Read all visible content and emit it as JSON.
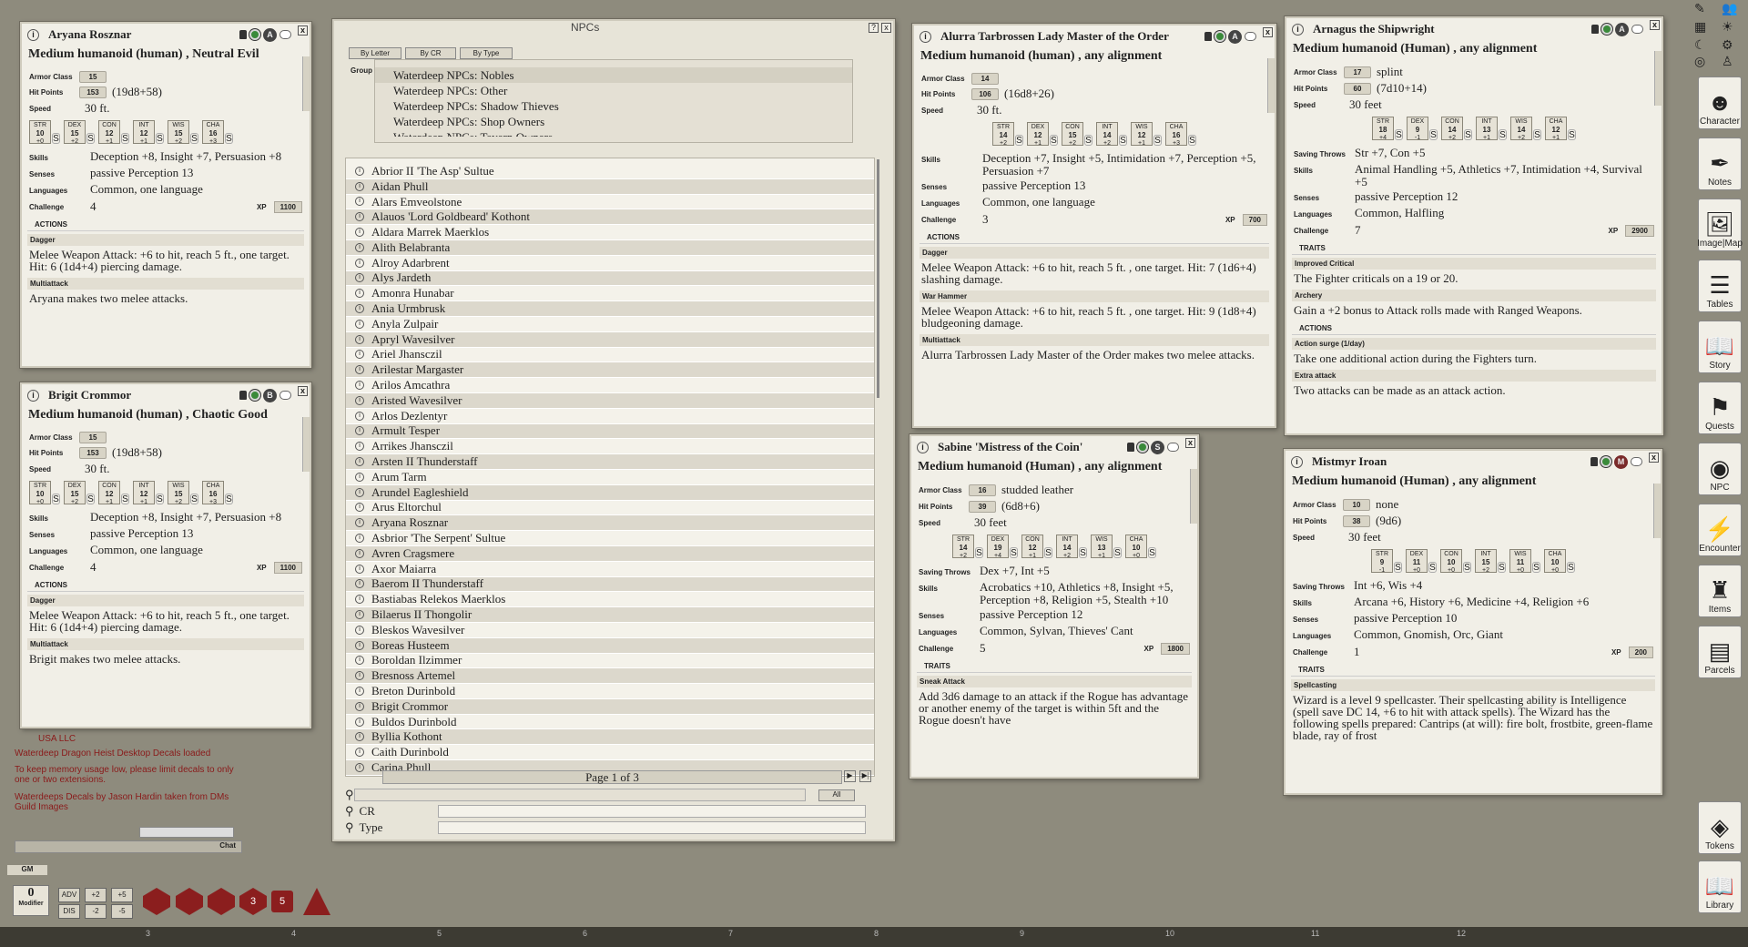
{
  "npc_window": {
    "title": "NPCs",
    "tabs": [
      "By Letter",
      "By CR",
      "By Type"
    ],
    "group_label": "Group",
    "groups": [
      "Waterdeep NPCs: Nobles",
      "Waterdeep NPCs: Other",
      "Waterdeep NPCs: Shadow Thieves",
      "Waterdeep NPCs: Shop Owners",
      "Waterdeep NPCs: Tavern Owners"
    ],
    "names": [
      "Abrior II 'The Asp' Sultue",
      "Aidan Phull",
      "Alars Emveolstone",
      "Alauos 'Lord Goldbeard' Kothont",
      "Aldara Marrek Maerklos",
      "Alith Belabranta",
      "Alroy Adarbrent",
      "Alys Jardeth",
      "Amonra Hunabar",
      "Ania Urmbrusk",
      "Anyla Zulpair",
      "Apryl Wavesilver",
      "Ariel Jhansczil",
      "Arilestar Margaster",
      "Arilos Amcathra",
      "Aristed Wavesilver",
      "Arlos Dezlentyr",
      "Armult Tesper",
      "Arrikes Jhansczil",
      "Arsten II Thunderstaff",
      "Arum Tarm",
      "Arundel Eagleshield",
      "Arus Eltorchul",
      "Aryana Rosznar",
      "Asbrior 'The Serpent' Sultue",
      "Avren Cragsmere",
      "Axor Maiarra",
      "Baerom II Thunderstaff",
      "Bastiabas Relekos Maerklos",
      "Bilaerus II Thongolir",
      "Bleskos Wavesilver",
      "Boreas Husteem",
      "Boroldan Ilzimmer",
      "Bresnoss Artemel",
      "Breton Durinbold",
      "Brigit Crommor",
      "Buldos Durinbold",
      "Byllia Kothont",
      "Caith Durinbold",
      "Carina Phull"
    ],
    "pager": "Page 1 of 3",
    "filter_all": "All",
    "filter_cr": "CR",
    "filter_type": "Type"
  },
  "cards": [
    {
      "name": "Aryana Rosznar",
      "token": "A",
      "type": "Medium humanoid (human) , Neutral Evil",
      "ac": "15",
      "ac_text": "",
      "hp": "153",
      "hp_text": "(19d8+58)",
      "speed": "30 ft.",
      "abil": [
        [
          "STR",
          "10",
          "+0"
        ],
        [
          "DEX",
          "15",
          "+2"
        ],
        [
          "CON",
          "12",
          "+1"
        ],
        [
          "INT",
          "12",
          "+1"
        ],
        [
          "WIS",
          "15",
          "+2"
        ],
        [
          "CHA",
          "16",
          "+3"
        ]
      ],
      "saves": "",
      "skills": "Deception +8, Insight +7, Persuasion +8",
      "senses": "passive Perception 13",
      "languages": "Common, one language",
      "challenge": "4",
      "xp": "1100",
      "sections": [
        {
          "h": "ACTIONS",
          "items": [
            {
              "n": "Dagger",
              "d": "Melee Weapon Attack: +6 to hit, reach 5 ft., one target. Hit: 6 (1d4+4) piercing damage."
            },
            {
              "n": "Multiattack",
              "d": "Aryana makes two melee attacks."
            }
          ]
        }
      ]
    },
    {
      "name": "Brigit Crommor",
      "token": "B",
      "type": "Medium humanoid (human) , Chaotic Good",
      "ac": "15",
      "ac_text": "",
      "hp": "153",
      "hp_text": "(19d8+58)",
      "speed": "30 ft.",
      "abil": [
        [
          "STR",
          "10",
          "+0"
        ],
        [
          "DEX",
          "15",
          "+2"
        ],
        [
          "CON",
          "12",
          "+1"
        ],
        [
          "INT",
          "12",
          "+1"
        ],
        [
          "WIS",
          "15",
          "+2"
        ],
        [
          "CHA",
          "16",
          "+3"
        ]
      ],
      "saves": "",
      "skills": "Deception +8, Insight +7, Persuasion +8",
      "senses": "passive Perception 13",
      "languages": "Common, one language",
      "challenge": "4",
      "xp": "1100",
      "sections": [
        {
          "h": "ACTIONS",
          "items": [
            {
              "n": "Dagger",
              "d": "Melee Weapon Attack: +6 to hit, reach 5 ft., one target. Hit: 6 (1d4+4) piercing damage."
            },
            {
              "n": "Multiattack",
              "d": "Brigit makes two melee attacks."
            }
          ]
        }
      ]
    },
    {
      "name": "Alurra Tarbrossen Lady Master of the Order",
      "token": "A",
      "type": "Medium humanoid (human) , any alignment",
      "ac": "14",
      "ac_text": "",
      "hp": "106",
      "hp_text": "(16d8+26)",
      "speed": "30 ft.",
      "abil": [
        [
          "STR",
          "14",
          "+2"
        ],
        [
          "DEX",
          "12",
          "+1"
        ],
        [
          "CON",
          "15",
          "+2"
        ],
        [
          "INT",
          "14",
          "+2"
        ],
        [
          "WIS",
          "12",
          "+1"
        ],
        [
          "CHA",
          "16",
          "+3"
        ]
      ],
      "saves": "",
      "skills": "Deception +7, Insight +5, Intimidation +7, Perception +5, Persuasion +7",
      "senses": "passive Perception 13",
      "languages": "Common, one language",
      "challenge": "3",
      "xp": "700",
      "sections": [
        {
          "h": "ACTIONS",
          "items": [
            {
              "n": "Dagger",
              "d": "Melee Weapon Attack: +6 to hit, reach 5 ft. , one target. Hit: 7 (1d6+4) slashing damage."
            },
            {
              "n": "War Hammer",
              "d": "Melee Weapon Attack: +6 to hit, reach 5 ft. , one target. Hit: 9 (1d8+4) bludgeoning damage."
            },
            {
              "n": "Multiattack",
              "d": "Alurra Tarbrossen Lady Master of the Order makes two melee attacks."
            }
          ]
        }
      ]
    },
    {
      "name": "Arnagus the Shipwright",
      "token": "A",
      "type": "Medium humanoid (Human) , any alignment",
      "ac": "17",
      "ac_text": "splint",
      "hp": "60",
      "hp_text": "(7d10+14)",
      "speed": "30 feet",
      "abil": [
        [
          "STR",
          "18",
          "+4"
        ],
        [
          "DEX",
          "9",
          "-1"
        ],
        [
          "CON",
          "14",
          "+2"
        ],
        [
          "INT",
          "13",
          "+1"
        ],
        [
          "WIS",
          "14",
          "+2"
        ],
        [
          "CHA",
          "12",
          "+1"
        ]
      ],
      "saves": "Str +7, Con +5",
      "skills": "Animal Handling +5, Athletics +7, Intimidation +4, Survival +5",
      "senses": "passive Perception 12",
      "languages": "Common, Halfling",
      "challenge": "7",
      "xp": "2900",
      "sections": [
        {
          "h": "TRAITS",
          "items": [
            {
              "n": "Improved Critical",
              "d": "The Fighter criticals on a 19 or 20."
            },
            {
              "n": "Archery",
              "d": "Gain a +2 bonus to Attack rolls made with Ranged Weapons."
            }
          ]
        },
        {
          "h": "ACTIONS",
          "items": [
            {
              "n": "Action surge (1/day)",
              "d": "Take one additional action during the Fighters turn."
            },
            {
              "n": "Extra attack",
              "d": "Two attacks can be made as an attack action."
            }
          ]
        }
      ]
    },
    {
      "name": "Sabine 'Mistress of the Coin'",
      "token": "S",
      "type": "Medium humanoid (Human) , any alignment",
      "ac": "16",
      "ac_text": "studded leather",
      "hp": "39",
      "hp_text": "(6d8+6)",
      "speed": "30 feet",
      "abil": [
        [
          "STR",
          "14",
          "+2"
        ],
        [
          "DEX",
          "19",
          "+4"
        ],
        [
          "CON",
          "12",
          "+1"
        ],
        [
          "INT",
          "14",
          "+2"
        ],
        [
          "WIS",
          "13",
          "+1"
        ],
        [
          "CHA",
          "10",
          "+0"
        ]
      ],
      "saves": "Dex +7, Int +5",
      "skills": "Acrobatics +10, Athletics +8, Insight +5, Perception +8, Religion +5, Stealth +10",
      "senses": "passive Perception 12",
      "languages": "Common, Sylvan, Thieves' Cant",
      "challenge": "5",
      "xp": "1800",
      "sections": [
        {
          "h": "TRAITS",
          "items": [
            {
              "n": "Sneak Attack",
              "d": "Add 3d6 damage to an attack if the Rogue has advantage or another enemy of the target is within 5ft and the Rogue doesn't have"
            }
          ]
        }
      ]
    },
    {
      "name": "Mistmyr Iroan",
      "token": "M",
      "type": "Medium humanoid (Human) , any alignment",
      "ac": "10",
      "ac_text": "none",
      "hp": "38",
      "hp_text": "(9d6)",
      "speed": "30 feet",
      "abil": [
        [
          "STR",
          "9",
          "-1"
        ],
        [
          "DEX",
          "11",
          "+0"
        ],
        [
          "CON",
          "10",
          "+0"
        ],
        [
          "INT",
          "15",
          "+2"
        ],
        [
          "WIS",
          "11",
          "+0"
        ],
        [
          "CHA",
          "10",
          "+0"
        ]
      ],
      "saves": "Int +6, Wis +4",
      "skills": "Arcana +6, History +6, Medicine +4, Religion +6",
      "senses": "passive Perception 10",
      "languages": "Common, Gnomish, Orc, Giant",
      "challenge": "1",
      "xp": "200",
      "sections": [
        {
          "h": "TRAITS",
          "items": [
            {
              "n": "Spellcasting",
              "d": "Wizard is a level 9 spellcaster. Their spellcasting ability is Intelligence (spell save DC 14, +6 to hit with attack spells). The Wizard has the following spells prepared: Cantrips (at will): fire bolt, frostbite, green-flame blade, ray of frost"
            }
          ]
        }
      ]
    }
  ],
  "labels": {
    "ac": "Armor Class",
    "hp": "Hit Points",
    "speed": "Speed",
    "saves": "Saving Throws",
    "skills": "Skills",
    "senses": "Senses",
    "languages": "Languages",
    "challenge": "Challenge",
    "xp": "XP"
  },
  "sidebar": [
    {
      "label": "Character",
      "icon": "character-icon"
    },
    {
      "label": "Notes",
      "icon": "notes-icon"
    },
    {
      "label": "Image|Map",
      "icon": "image-icon"
    },
    {
      "label": "Tables",
      "icon": "tables-icon"
    },
    {
      "label": "Story",
      "icon": "story-icon"
    },
    {
      "label": "Quests",
      "icon": "quests-icon"
    },
    {
      "label": "NPC",
      "icon": "npc-icon"
    },
    {
      "label": "Encounter",
      "icon": "encounter-icon"
    },
    {
      "label": "Items",
      "icon": "items-icon"
    },
    {
      "label": "Parcels",
      "icon": "parcels-icon"
    }
  ],
  "sidebar_bottom": [
    {
      "label": "Tokens"
    },
    {
      "label": "Library"
    }
  ],
  "chat": {
    "lines": [
      "USA LLC",
      "Waterdeep Dragon Heist Desktop Decals loaded",
      "To keep memory usage low, please limit decals to only one or two extensions.",
      "Waterdeeps Decals by Jason Hardin taken from DMs Guild Images"
    ],
    "chat_label": "Chat",
    "gm": "GM"
  },
  "modifier": {
    "value": "0",
    "label": "Modifier",
    "buttons": [
      "ADV",
      "+2",
      "+5",
      "DIS",
      "-2",
      "-5"
    ]
  },
  "dice": [
    "",
    "",
    "",
    "3",
    "5",
    ""
  ],
  "ruler": [
    "3",
    "4",
    "5",
    "6",
    "7",
    "8",
    "9",
    "10",
    "11",
    "12"
  ]
}
